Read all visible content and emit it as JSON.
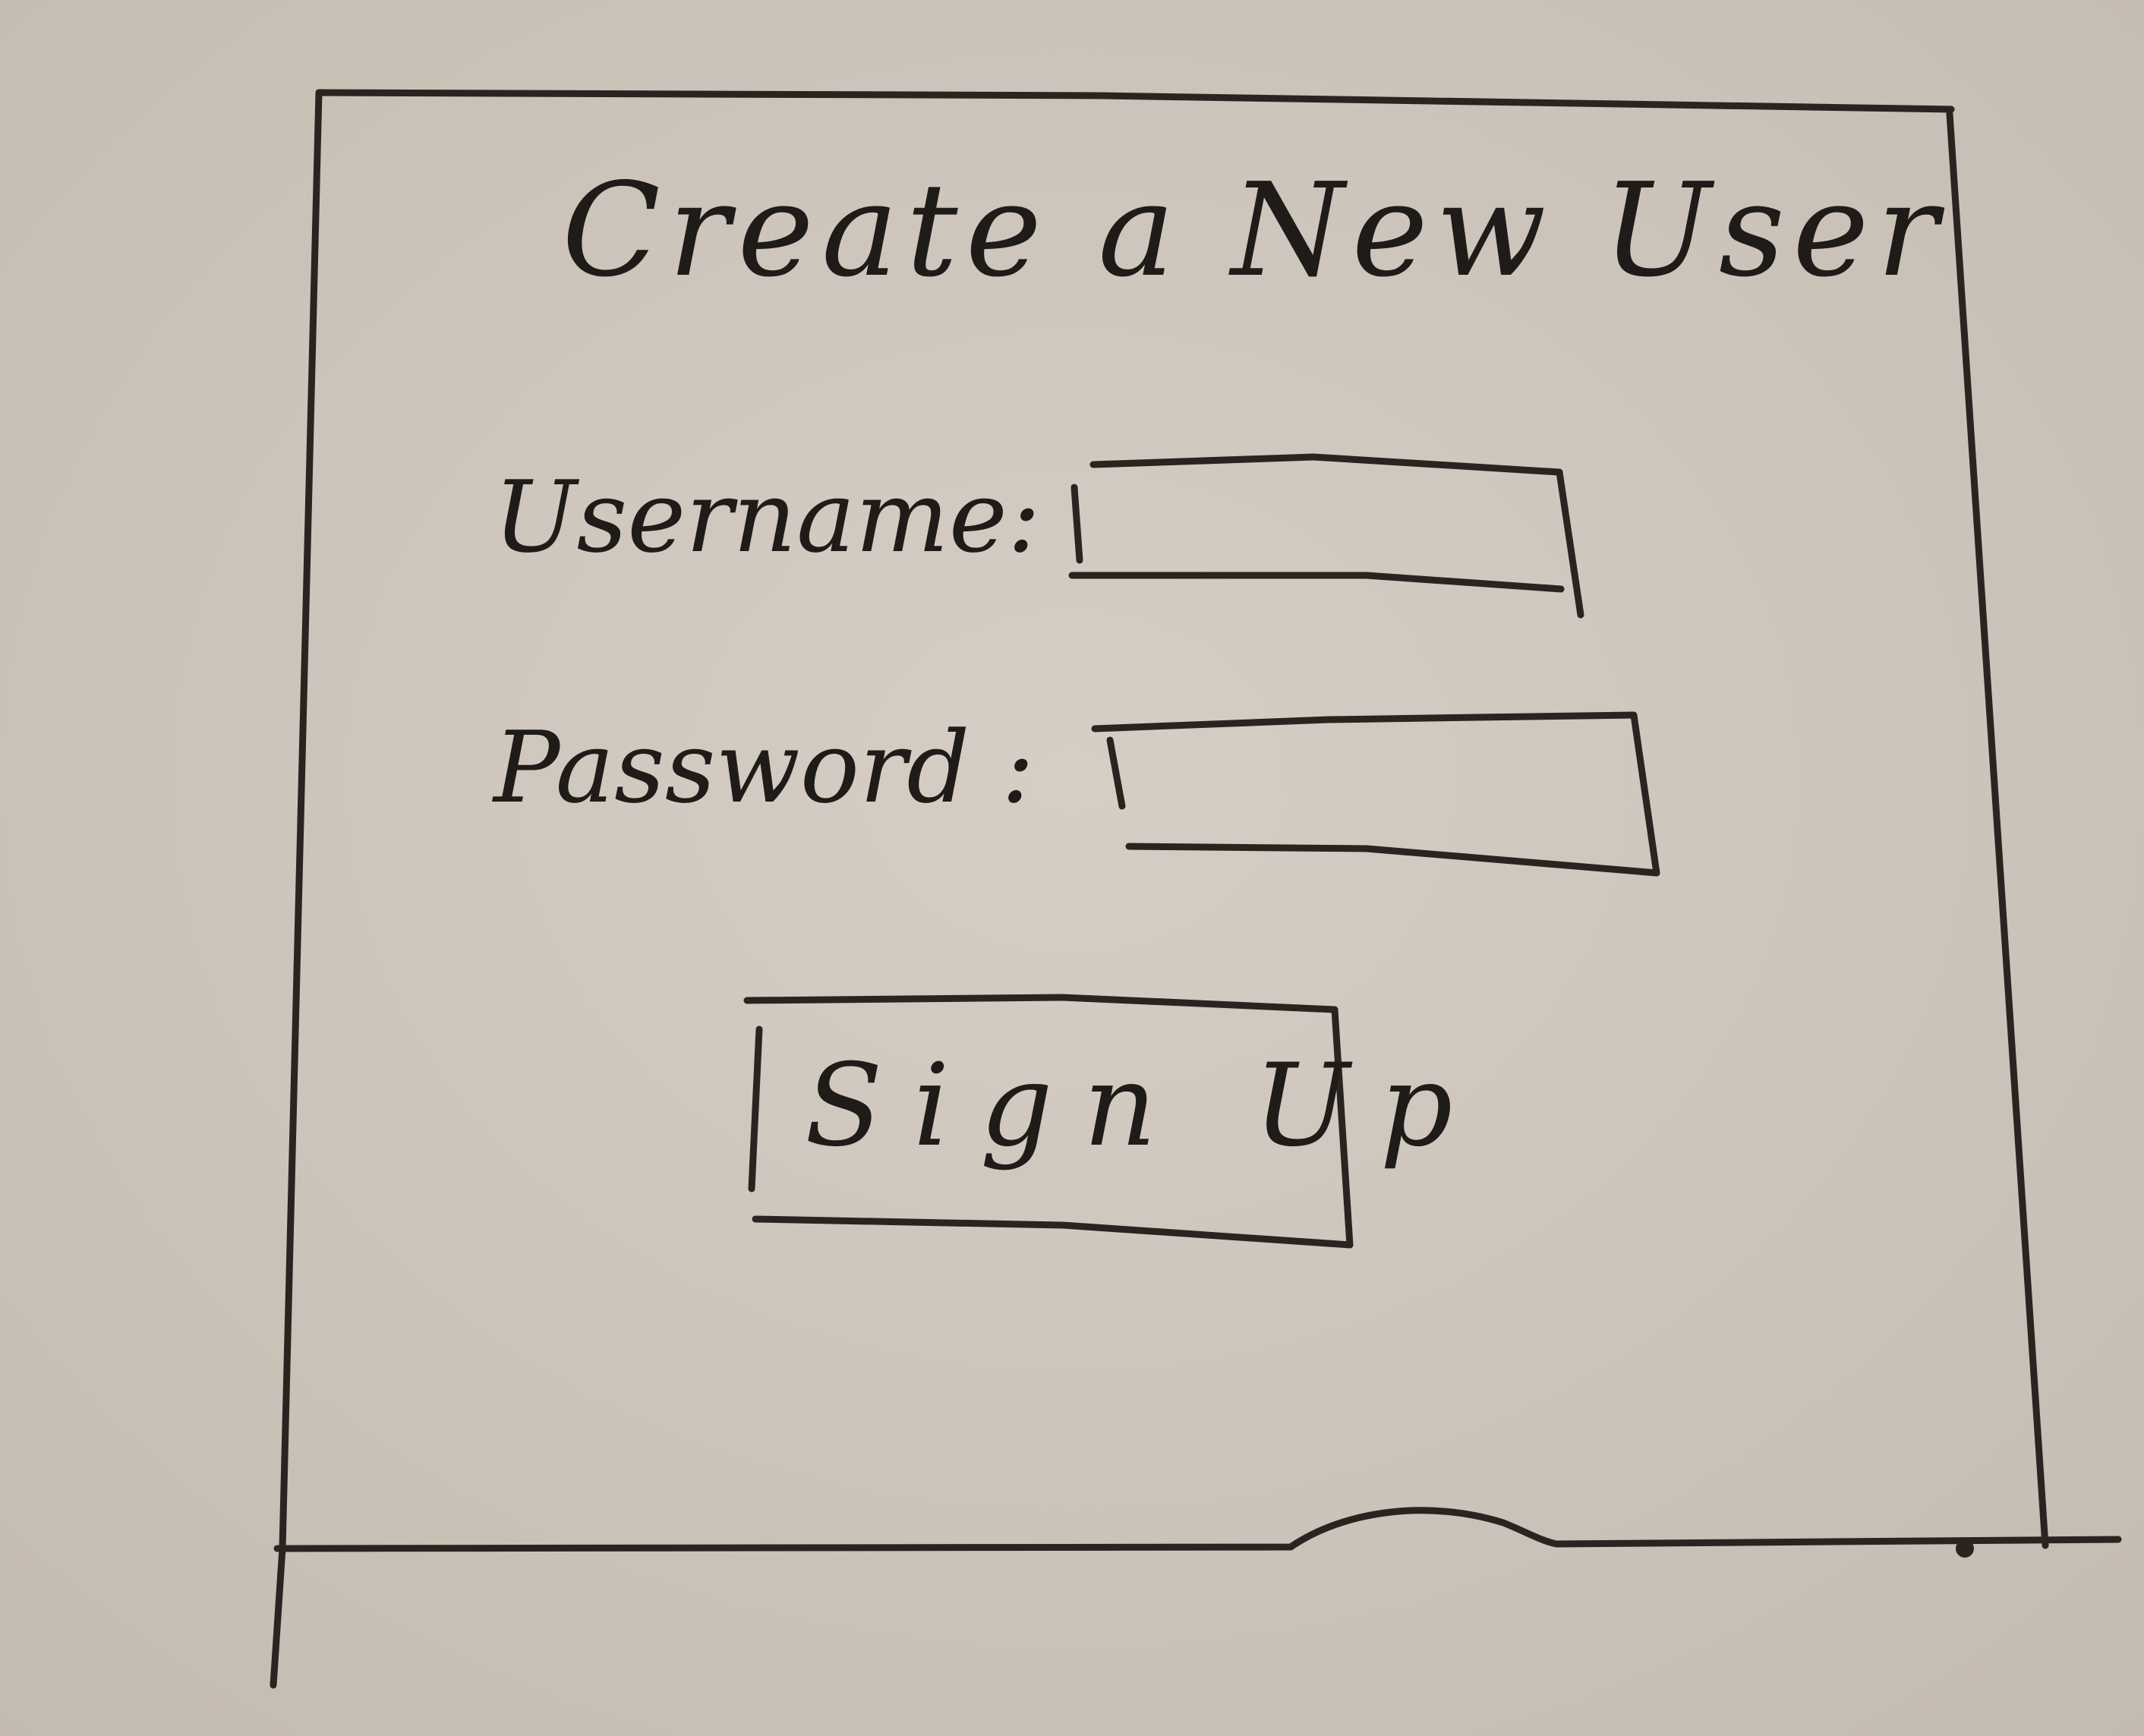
{
  "form": {
    "title": "Create a New User",
    "username_label": "Username:",
    "username_value": "",
    "password_label": "Password :",
    "password_value": "",
    "submit_label": "Sign Up"
  }
}
